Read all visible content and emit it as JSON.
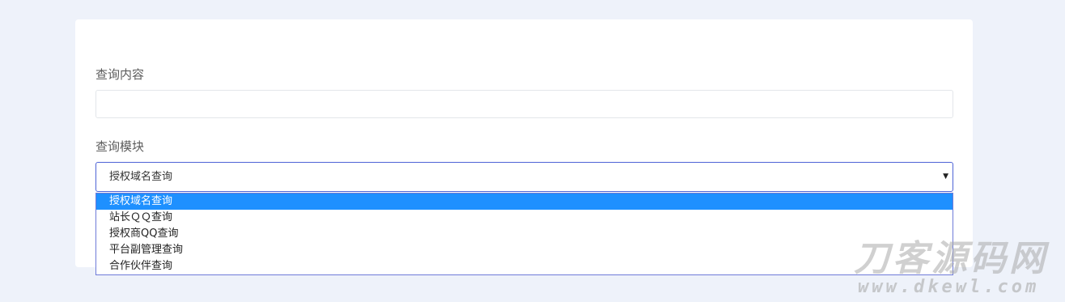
{
  "form": {
    "query_label": "查询内容",
    "query_value": "",
    "query_placeholder": "",
    "module_label": "查询模块",
    "module_selected": "授权域名查询",
    "module_options": [
      {
        "label": "授权域名查询",
        "selected": true
      },
      {
        "label": "站长ＱＱ查询",
        "selected": false
      },
      {
        "label": "授权商QQ查询",
        "selected": false
      },
      {
        "label": "平台副管理查询",
        "selected": false
      },
      {
        "label": "合作伙伴查询",
        "selected": false
      }
    ]
  },
  "icons": {
    "select_arrow": "chevron-down-icon"
  },
  "colors": {
    "page_background": "#eef2fa",
    "card_background": "#ffffff",
    "focus_border": "#4e63d6",
    "option_highlight": "#1e90ff"
  },
  "watermark": {
    "brand": "刀客源码网",
    "url": "www.dkewl.com"
  }
}
